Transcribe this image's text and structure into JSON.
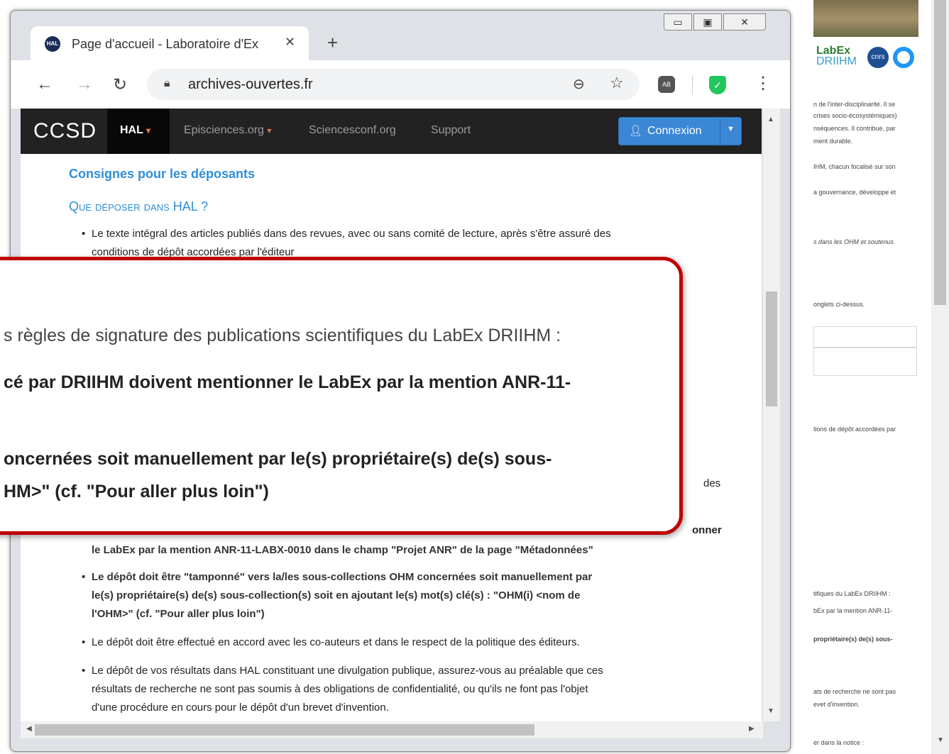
{
  "browser": {
    "tab_title": "Page d'accueil - Laboratoire d'Ex",
    "tab_favicon": "HAL",
    "url": "archives-ouvertes.fr",
    "ext1_label": "AB"
  },
  "navbar": {
    "brand": "CCSD",
    "items": [
      "HAL",
      "Episciences.org",
      "Sciencesconf.org",
      "Support"
    ],
    "login": "Connexion"
  },
  "content": {
    "section_title": "Consignes pour les déposants",
    "subsection": "Que déposer dans HAL ?",
    "bullet1_a": "Le texte intégral des articles publiés dans des revues, avec ou sans comité de lecture, après s'être assuré des",
    "bullet1_b": "conditions de dépôt accordées par l'éditeur",
    "fragment_des": "des",
    "fragment_onner": "onner",
    "bullet_anr": "le LabEx par la mention ANR-11-LABX-0010 dans le champ \"Projet ANR\" de la page \"Métadonnées\"",
    "bullet_tamp_a": "Le dépôt doit être \"tamponné\" vers la/les sous-collections OHM concernées soit manuellement par",
    "bullet_tamp_b": "le(s) propriétaire(s) de(s) sous-collection(s) soit en ajoutant le(s) mot(s) clé(s) : \"OHM(i) <nom de",
    "bullet_tamp_c": "l'OHM>\" (cf. \"Pour aller plus loin\")",
    "bullet_accord": "Le dépôt doit être effectué en accord avec les co-auteurs et dans le respect de la politique des éditeurs.",
    "bullet_div_a": "Le dépôt de vos résultats dans HAL constituant une divulgation publique, assurez-vous au préalable que ces",
    "bullet_div_b": "résultats de recherche ne sont pas soumis à des obligations de confidentialité, ou qu'ils ne font pas l'objet",
    "bullet_div_c": "d'une procédure en cours pour le dépôt d'un brevet d'invention."
  },
  "callout": {
    "line1": "s règles de signature des publications scientifiques du LabEx DRIIHM :",
    "line2": "cé par DRIIHM doivent mentionner le LabEx par la mention ANR-11-",
    "line3": "oncernées soit manuellement par le(s) propriétaire(s) de(s) sous-",
    "line4": "HM>\" (cf. \"Pour aller plus loin\")"
  },
  "background": {
    "logo_text_a": "LabEx",
    "logo_text_b": "DRIIHM",
    "logo_cnrs": "cnrs",
    "lines": [
      "n de l'inter-disciplinarité. Il se",
      "crises socio-écosystémiques)",
      "nséquences. Il contribue, par",
      "ment durable.",
      "IHM, chacun focalisé sur son",
      "a gouvernance, développe et",
      "s dans les OHM et soutenus",
      "onglets ci-dessus.",
      "tions de dépôt accordées par",
      "tifiques du LabEx DRIIHM :",
      "bEx par la mention ANR-11-",
      "propriétaire(s) de(s) sous-",
      "ats de recherche ne sont pas",
      "evet d'invention.",
      "er dans la notice :"
    ]
  }
}
